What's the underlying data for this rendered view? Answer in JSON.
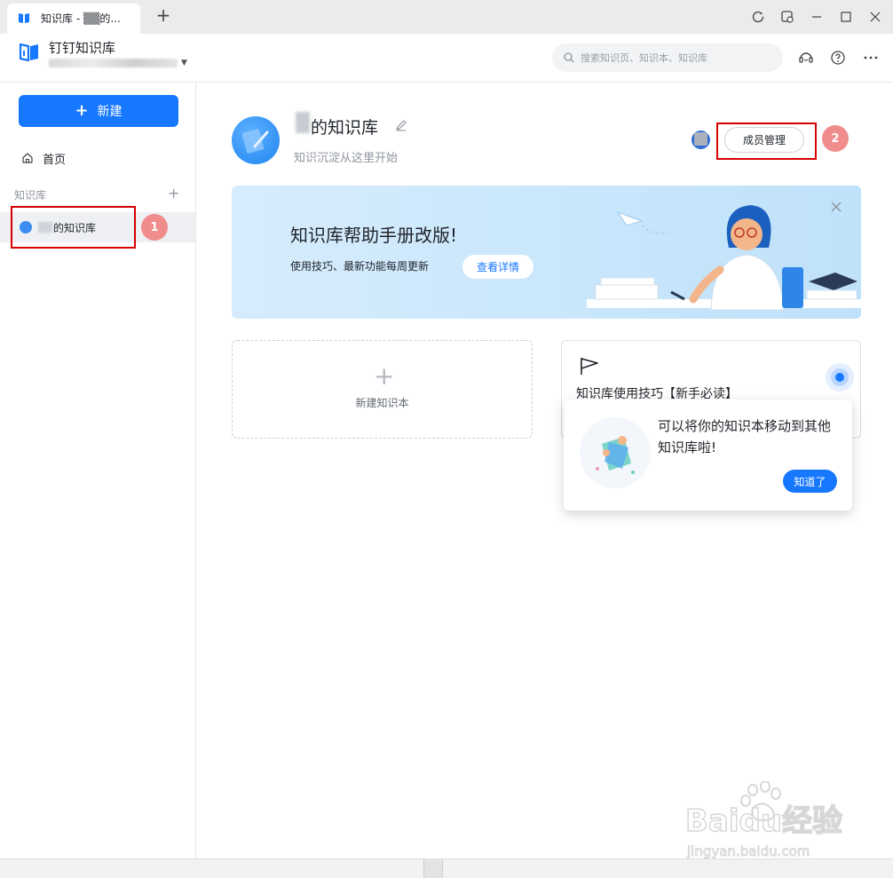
{
  "browser": {
    "tab_title": "知识库 - ▒▒的...",
    "new_tab_label": "+"
  },
  "app": {
    "name": "钉钉知识库",
    "search_placeholder": "搜索知识页、知识本、知识库",
    "header_icons": [
      "support-icon",
      "help-icon",
      "more-icon"
    ]
  },
  "sidebar": {
    "new_button": "新建",
    "home_label": "首页",
    "section_label": "知识库",
    "kb_items": [
      {
        "label": "的知识库"
      }
    ]
  },
  "kb": {
    "title": "的知识库",
    "subtitle": "知识沉淀从这里开始",
    "member_button": "成员管理"
  },
  "annotations": {
    "badge_1": "1",
    "badge_2": "2"
  },
  "banner": {
    "title": "知识库帮助手册改版!",
    "description": "使用技巧、最新功能每周更新",
    "button": "查看详情"
  },
  "cards": {
    "new_notebook_label": "新建知识本",
    "tips_title": "知识库使用技巧【新手必读】"
  },
  "popover": {
    "text": "可以将你的知识本移动到其他知识库啦!",
    "button": "知道了"
  },
  "watermark": {
    "brand": "Baidu经验",
    "url": "jingyan.baidu.com"
  },
  "colors": {
    "accent": "#1677ff",
    "highlight_box": "#d40000",
    "badge": "#f08c8c",
    "banner_bg": "#d6ecfc"
  }
}
